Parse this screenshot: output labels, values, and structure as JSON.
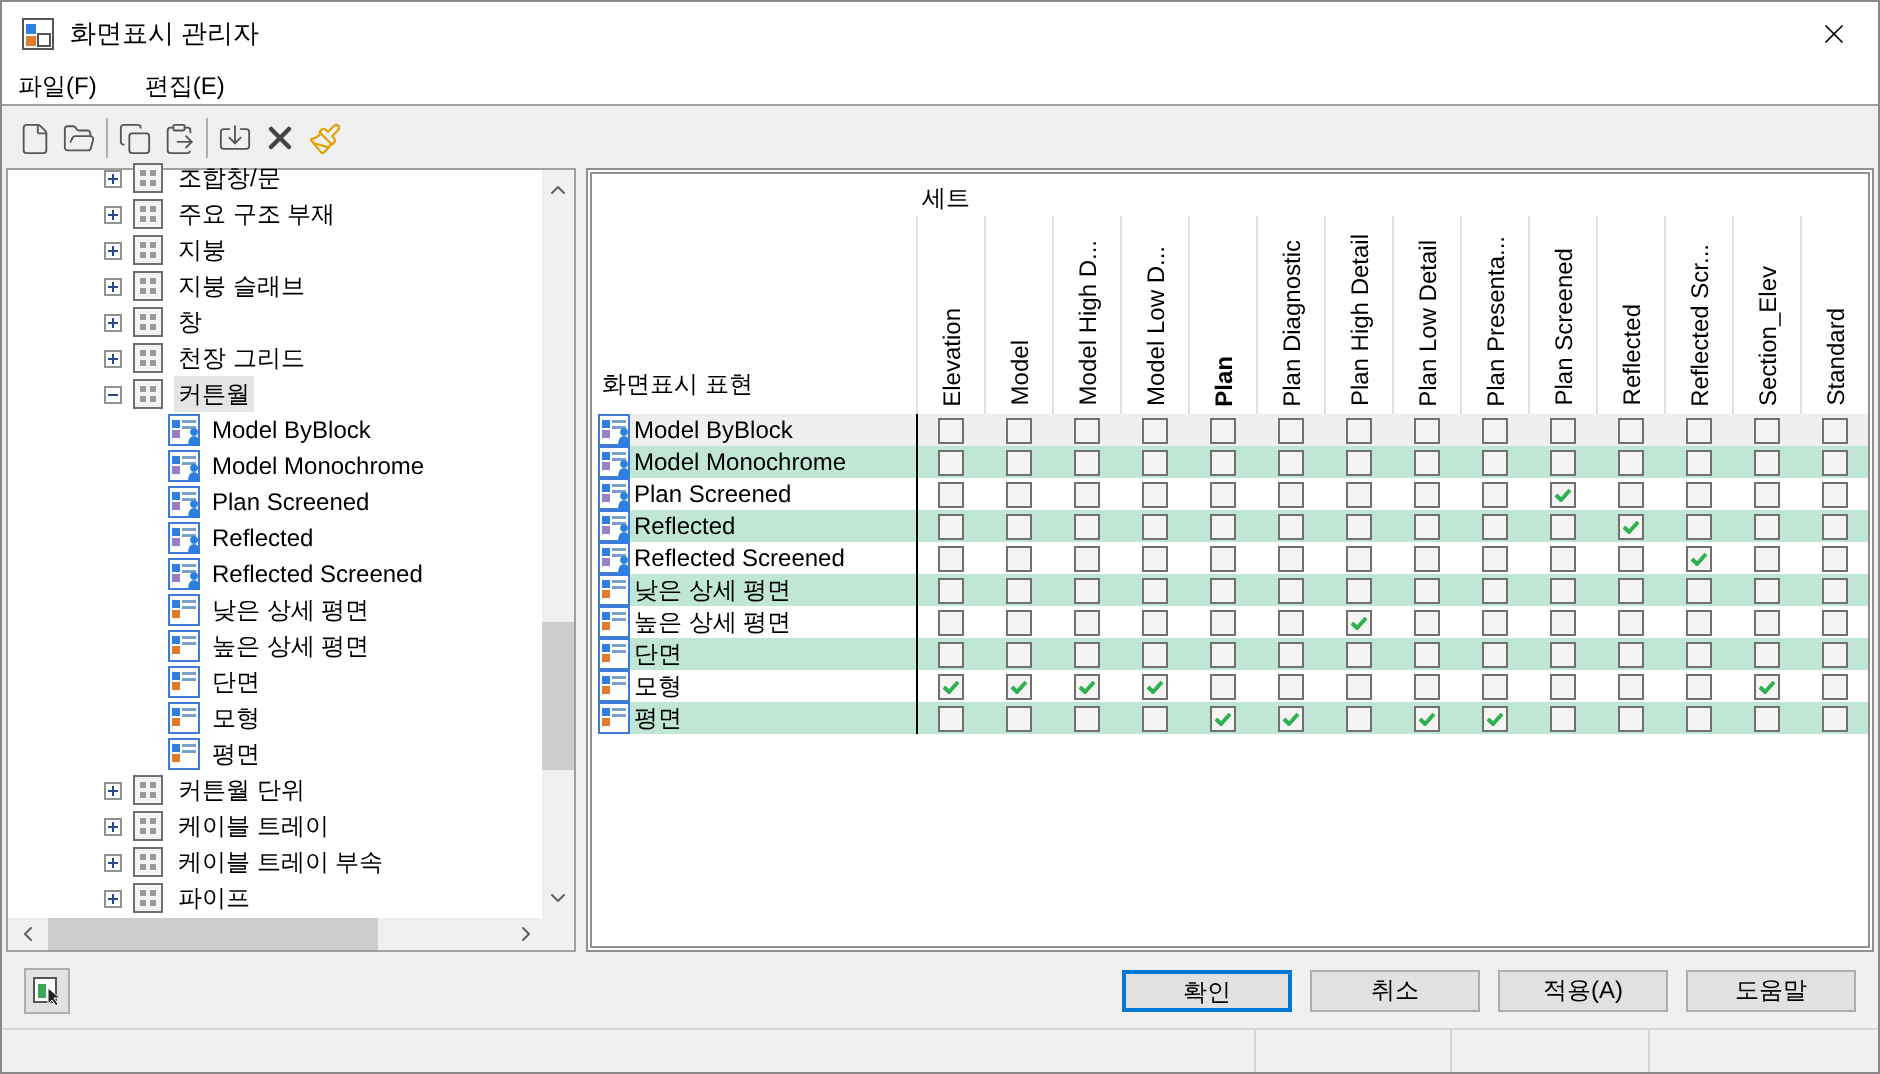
{
  "window": {
    "title": "화면표시 관리자"
  },
  "menu": [
    "파일(F)",
    "편집(E)"
  ],
  "tree": [
    {
      "label": "조합창/문",
      "expanded": false,
      "selected": false
    },
    {
      "label": "주요 구조 부재",
      "expanded": false,
      "selected": false
    },
    {
      "label": "지붕",
      "expanded": false,
      "selected": false
    },
    {
      "label": "지붕 슬래브",
      "expanded": false,
      "selected": false
    },
    {
      "label": "창",
      "expanded": false,
      "selected": false
    },
    {
      "label": "천장 그리드",
      "expanded": false,
      "selected": false
    },
    {
      "label": "커튼월",
      "expanded": true,
      "selected": true,
      "children": [
        {
          "label": "Model ByBlock",
          "kind": "shared"
        },
        {
          "label": "Model Monochrome",
          "kind": "shared"
        },
        {
          "label": "Plan Screened",
          "kind": "shared"
        },
        {
          "label": "Reflected",
          "kind": "shared"
        },
        {
          "label": "Reflected Screened",
          "kind": "shared"
        },
        {
          "label": "낮은 상세 평면",
          "kind": "plain"
        },
        {
          "label": "높은 상세 평면",
          "kind": "plain"
        },
        {
          "label": "단면",
          "kind": "plain"
        },
        {
          "label": "모형",
          "kind": "plain"
        },
        {
          "label": "평면",
          "kind": "plain"
        }
      ]
    },
    {
      "label": "커튼월 단위",
      "expanded": false,
      "selected": false
    },
    {
      "label": "케이블 트레이",
      "expanded": false,
      "selected": false
    },
    {
      "label": "케이블 트레이 부속",
      "expanded": false,
      "selected": false
    },
    {
      "label": "파이프",
      "expanded": false,
      "selected": false
    }
  ],
  "grid": {
    "group_heading": "세트",
    "row_heading": "화면표시 표현",
    "columns": [
      {
        "label": "Elevation",
        "bold": false
      },
      {
        "label": "Model",
        "bold": false
      },
      {
        "label": "Model High D...",
        "bold": false
      },
      {
        "label": "Model Low D...",
        "bold": false
      },
      {
        "label": "Plan",
        "bold": true
      },
      {
        "label": "Plan Diagnostic",
        "bold": false
      },
      {
        "label": "Plan High Detail",
        "bold": false
      },
      {
        "label": "Plan Low Detail",
        "bold": false
      },
      {
        "label": "Plan Presenta...",
        "bold": false
      },
      {
        "label": "Plan Screened",
        "bold": false
      },
      {
        "label": "Reflected",
        "bold": false
      },
      {
        "label": "Reflected Scr...",
        "bold": false
      },
      {
        "label": "Section_Elev",
        "bold": false
      },
      {
        "label": "Standard",
        "bold": false
      }
    ],
    "rows": [
      {
        "label": "Model ByBlock",
        "kind": "shared",
        "selected": true,
        "checks": [
          false,
          false,
          false,
          false,
          false,
          false,
          false,
          false,
          false,
          false,
          false,
          false,
          false,
          false
        ]
      },
      {
        "label": "Model Monochrome",
        "kind": "shared",
        "selected": false,
        "checks": [
          false,
          false,
          false,
          false,
          false,
          false,
          false,
          false,
          false,
          false,
          false,
          false,
          false,
          false
        ]
      },
      {
        "label": "Plan Screened",
        "kind": "shared",
        "selected": false,
        "checks": [
          false,
          false,
          false,
          false,
          false,
          false,
          false,
          false,
          false,
          true,
          false,
          false,
          false,
          false
        ]
      },
      {
        "label": "Reflected",
        "kind": "shared",
        "selected": false,
        "checks": [
          false,
          false,
          false,
          false,
          false,
          false,
          false,
          false,
          false,
          false,
          true,
          false,
          false,
          false
        ]
      },
      {
        "label": "Reflected Screened",
        "kind": "shared",
        "selected": false,
        "checks": [
          false,
          false,
          false,
          false,
          false,
          false,
          false,
          false,
          false,
          false,
          false,
          true,
          false,
          false
        ]
      },
      {
        "label": "낮은 상세 평면",
        "kind": "plain",
        "selected": false,
        "checks": [
          false,
          false,
          false,
          false,
          false,
          false,
          false,
          false,
          false,
          false,
          false,
          false,
          false,
          false
        ]
      },
      {
        "label": "높은 상세 평면",
        "kind": "plain",
        "selected": false,
        "checks": [
          false,
          false,
          false,
          false,
          false,
          false,
          true,
          false,
          false,
          false,
          false,
          false,
          false,
          false
        ]
      },
      {
        "label": "단면",
        "kind": "plain",
        "selected": false,
        "checks": [
          false,
          false,
          false,
          false,
          false,
          false,
          false,
          false,
          false,
          false,
          false,
          false,
          false,
          false
        ]
      },
      {
        "label": "모형",
        "kind": "plain",
        "selected": false,
        "checks": [
          true,
          true,
          true,
          true,
          false,
          false,
          false,
          false,
          false,
          false,
          false,
          false,
          true,
          false
        ]
      },
      {
        "label": "평면",
        "kind": "plain",
        "selected": false,
        "checks": [
          false,
          false,
          false,
          false,
          true,
          true,
          false,
          true,
          true,
          false,
          false,
          false,
          false,
          false
        ]
      }
    ]
  },
  "buttons": [
    {
      "label": "확인",
      "default": true
    },
    {
      "label": "취소",
      "default": false
    },
    {
      "label": "적용(A)",
      "default": false
    },
    {
      "label": "도움말",
      "default": false
    }
  ]
}
